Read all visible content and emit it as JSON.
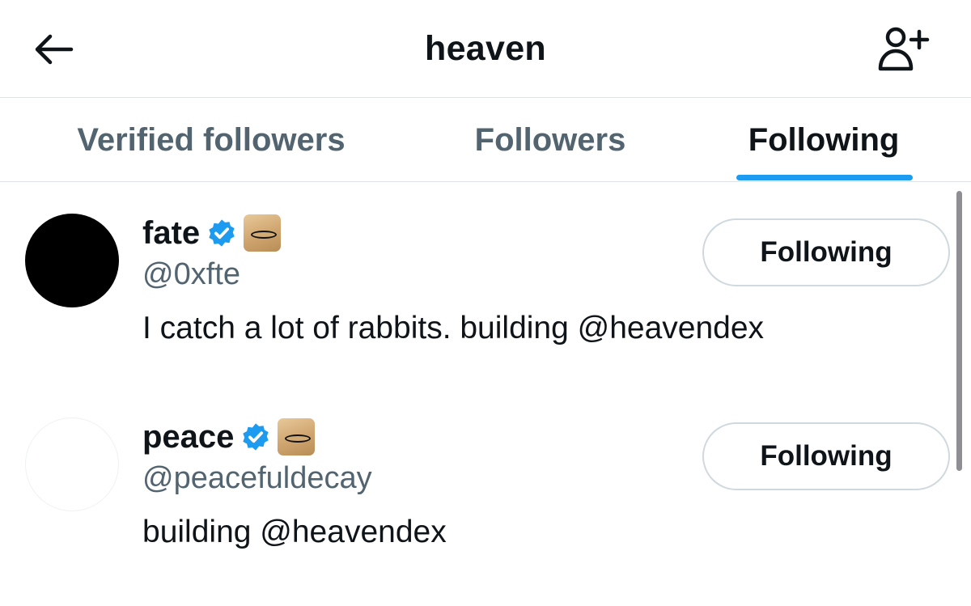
{
  "header": {
    "title": "heaven",
    "back_icon": "arrow-left-icon",
    "add_icon": "add-person-icon"
  },
  "tabs": [
    {
      "label": "Verified followers",
      "active": false
    },
    {
      "label": "Followers",
      "active": false
    },
    {
      "label": "Following",
      "active": true
    }
  ],
  "accent_color": "#1d9bf0",
  "users": [
    {
      "name": "fate",
      "handle": "@0xfte",
      "bio": "I catch a lot of rabbits. building @heavendex",
      "verified": true,
      "button_label": "Following"
    },
    {
      "name": "peace",
      "handle": "@peacefuldecay",
      "bio": "building @heavendex",
      "verified": true,
      "button_label": "Following"
    }
  ]
}
